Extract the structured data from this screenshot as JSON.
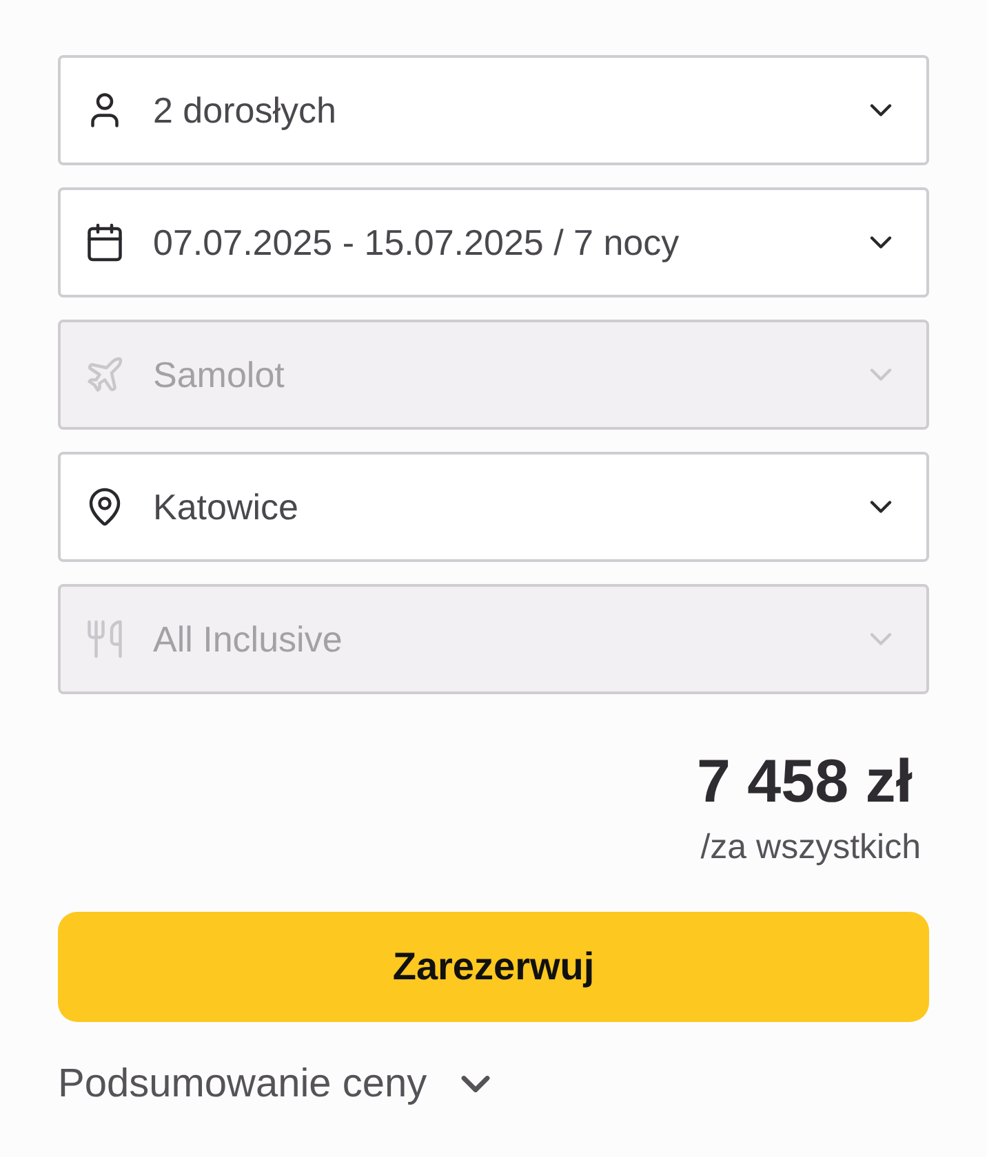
{
  "fields": [
    {
      "kind": "travelers",
      "value": "2 dorosłych",
      "disabled": false
    },
    {
      "kind": "dates",
      "value": "07.07.2025 - 15.07.2025 / 7 nocy",
      "disabled": false
    },
    {
      "kind": "transport",
      "value": "Samolot",
      "disabled": true
    },
    {
      "kind": "departure",
      "value": "Katowice",
      "disabled": false
    },
    {
      "kind": "board",
      "value": "All Inclusive",
      "disabled": true
    }
  ],
  "price": {
    "amount": "7 458 zł",
    "note": "/za wszystkich"
  },
  "book_button": {
    "label": "Zarezerwuj"
  },
  "summary": {
    "label": "Podsumowanie ceny",
    "expanded": false
  }
}
